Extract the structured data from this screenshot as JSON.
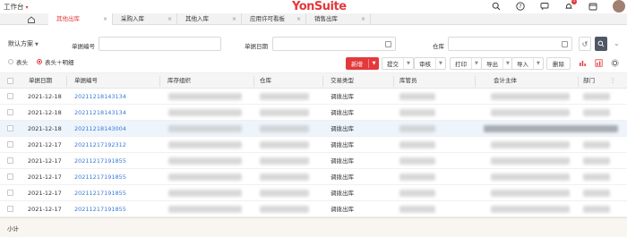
{
  "topbar": {
    "workspace_label": "工作台",
    "brand_main": "YonSuite",
    "message_badge": "1",
    "icons": [
      "search-icon",
      "help-icon",
      "chat-icon",
      "bell-icon",
      "calendar-icon",
      "avatar"
    ]
  },
  "tabs": [
    {
      "label": "其他出库",
      "active": true
    },
    {
      "label": "采购入库",
      "active": false
    },
    {
      "label": "其他入库",
      "active": false
    },
    {
      "label": "应用许可看板",
      "active": false
    },
    {
      "label": "销售出库",
      "active": false
    }
  ],
  "filter": {
    "scheme_label": "默认方案",
    "doc_no_label": "单据编号",
    "doc_date_label": "单据日期",
    "warehouse_label": "仓库",
    "radio_header": "表头",
    "radio_header_detail": "表头＋明细"
  },
  "toolbar": {
    "new": "新增",
    "submit": "提交",
    "approve": "审核",
    "print": "打印",
    "export": "导出",
    "import": "导入",
    "delete": "删除"
  },
  "grid": {
    "columns": [
      "单据日期",
      "单据编号",
      "库存组织",
      "仓库",
      "交易类型",
      "库管员",
      "会计主体",
      "部门"
    ],
    "rows": [
      {
        "date": "2021-12-18",
        "no": "20211218143134",
        "type": "调拨出库"
      },
      {
        "date": "2021-12-18",
        "no": "20211218143134",
        "type": "调拨出库"
      },
      {
        "date": "2021-12-18",
        "no": "20211218143004",
        "type": "调拨出库"
      },
      {
        "date": "2021-12-17",
        "no": "20211217192312",
        "type": "调拨出库"
      },
      {
        "date": "2021-12-17",
        "no": "20211217191855",
        "type": "调拨出库"
      },
      {
        "date": "2021-12-17",
        "no": "20211217191855",
        "type": "调拨出库"
      },
      {
        "date": "2021-12-17",
        "no": "20211217191855",
        "type": "调拨出库"
      },
      {
        "date": "2021-12-17",
        "no": "20211217191855",
        "type": "调拨出库"
      }
    ]
  },
  "summary": {
    "label": "小计"
  },
  "colors": {
    "accent": "#e4393c",
    "link": "#3a7bd5"
  }
}
